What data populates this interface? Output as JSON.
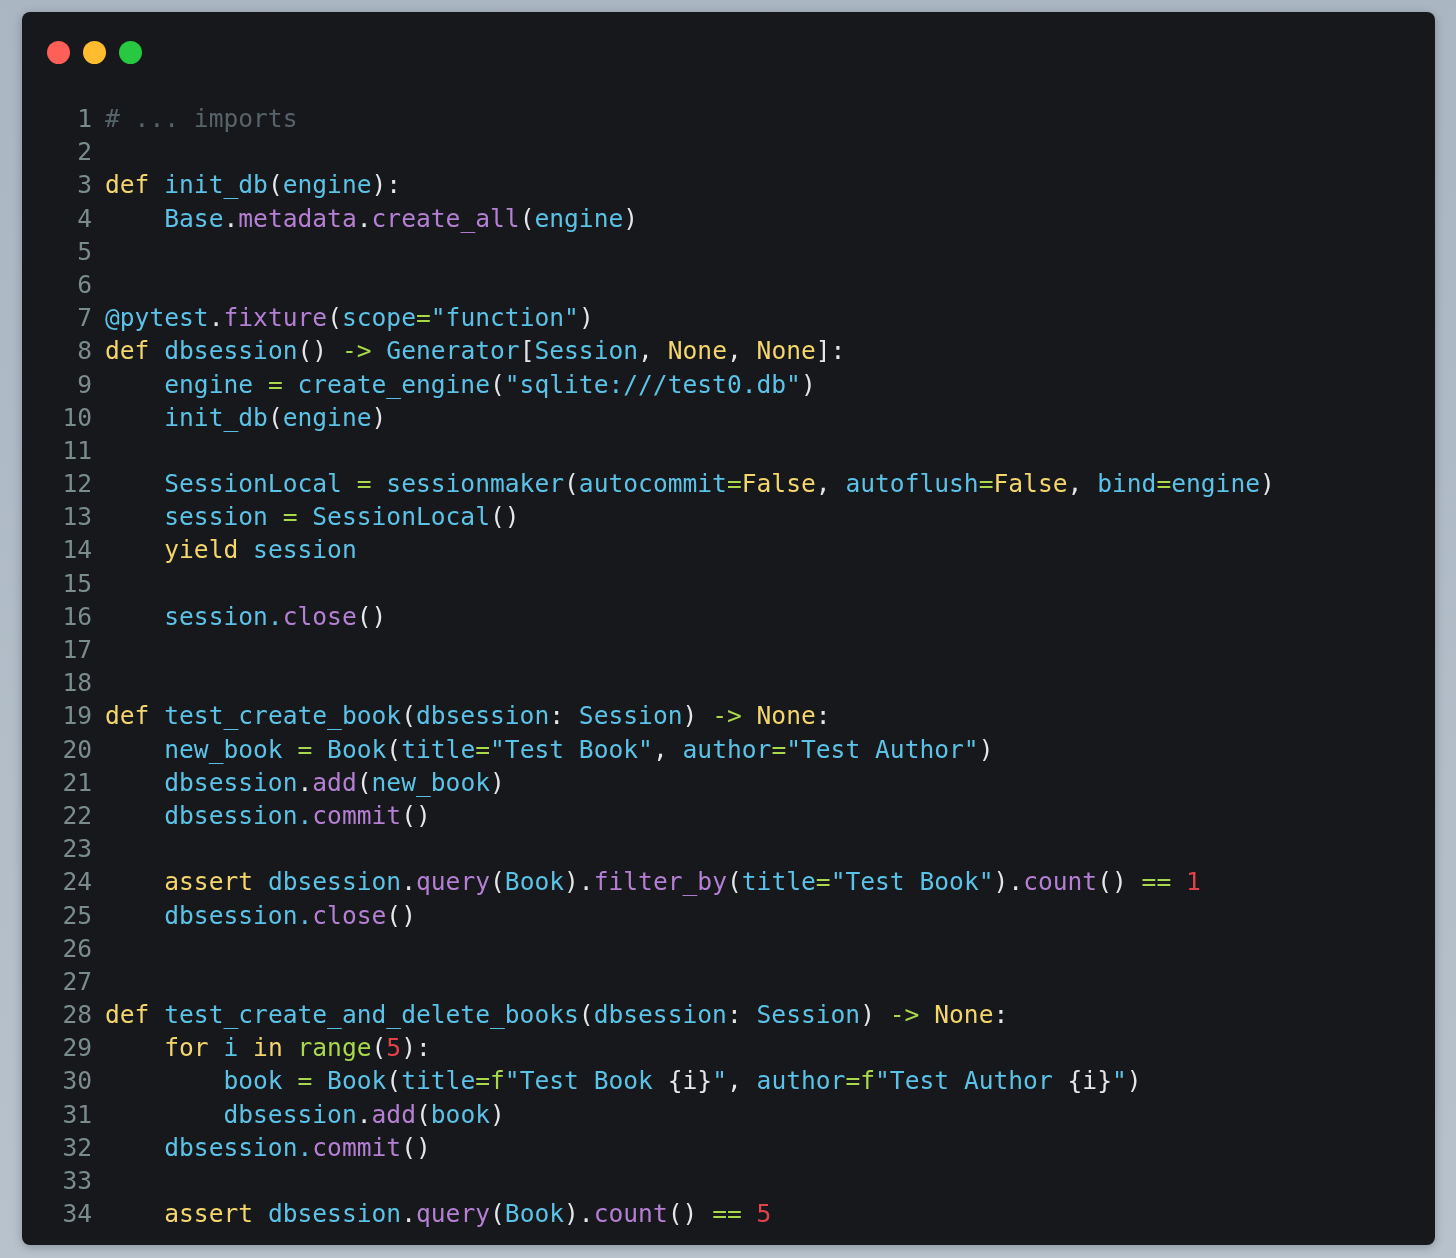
{
  "editor": {
    "lines": [
      {
        "number": "1",
        "tokens": [
          {
            "kind": "comment",
            "text": "# ... imports"
          }
        ]
      },
      {
        "number": "2"
      },
      {
        "number": "3",
        "tokens": [
          {
            "kind": "keyword",
            "text": "def"
          },
          {
            "kind": "name",
            "text": " init_db"
          },
          {
            "kind": "punct",
            "text": "("
          },
          {
            "kind": "name",
            "text": "engine"
          },
          {
            "kind": "punct",
            "text": "):"
          }
        ]
      },
      {
        "number": "4",
        "tokens": [
          {
            "kind": "name",
            "text": "    Base"
          },
          {
            "kind": "punct",
            "text": "."
          },
          {
            "kind": "method",
            "text": "metadata"
          },
          {
            "kind": "punct",
            "text": "."
          },
          {
            "kind": "method",
            "text": "create_all"
          },
          {
            "kind": "punct",
            "text": "("
          },
          {
            "kind": "name",
            "text": "engine"
          },
          {
            "kind": "punct",
            "text": ")"
          }
        ]
      },
      {
        "number": "5"
      },
      {
        "number": "6"
      },
      {
        "number": "7",
        "tokens": [
          {
            "kind": "name",
            "text": "@pytest"
          },
          {
            "kind": "punct",
            "text": "."
          },
          {
            "kind": "method",
            "text": "fixture"
          },
          {
            "kind": "punct",
            "text": "("
          },
          {
            "kind": "name",
            "text": "scope"
          },
          {
            "kind": "operator",
            "text": "="
          },
          {
            "kind": "name",
            "text": "\"function\""
          },
          {
            "kind": "punct",
            "text": ")"
          }
        ]
      },
      {
        "number": "8",
        "tokens": [
          {
            "kind": "keyword",
            "text": "def"
          },
          {
            "kind": "name",
            "text": " dbsession"
          },
          {
            "kind": "punct",
            "text": "() "
          },
          {
            "kind": "operator",
            "text": "->"
          },
          {
            "kind": "name",
            "text": " Generator"
          },
          {
            "kind": "punct",
            "text": "["
          },
          {
            "kind": "name",
            "text": "Session"
          },
          {
            "kind": "punct",
            "text": ", "
          },
          {
            "kind": "keyword",
            "text": "None"
          },
          {
            "kind": "punct",
            "text": ", "
          },
          {
            "kind": "keyword",
            "text": "None"
          },
          {
            "kind": "punct",
            "text": "]:"
          }
        ]
      },
      {
        "number": "9",
        "tokens": [
          {
            "kind": "name",
            "text": "    engine "
          },
          {
            "kind": "operator",
            "text": "="
          },
          {
            "kind": "name",
            "text": " create_engine"
          },
          {
            "kind": "punct",
            "text": "("
          },
          {
            "kind": "name",
            "text": "\"sqlite:///test0.db\""
          },
          {
            "kind": "punct",
            "text": ")"
          }
        ]
      },
      {
        "number": "10",
        "tokens": [
          {
            "kind": "name",
            "text": "    init_db"
          },
          {
            "kind": "punct",
            "text": "("
          },
          {
            "kind": "name",
            "text": "engine"
          },
          {
            "kind": "punct",
            "text": ")"
          }
        ]
      },
      {
        "number": "11"
      },
      {
        "number": "12",
        "tokens": [
          {
            "kind": "name",
            "text": "    SessionLocal "
          },
          {
            "kind": "operator",
            "text": "="
          },
          {
            "kind": "name",
            "text": " sessionmaker"
          },
          {
            "kind": "punct",
            "text": "("
          },
          {
            "kind": "name",
            "text": "autocommit"
          },
          {
            "kind": "operator",
            "text": "="
          },
          {
            "kind": "keyword",
            "text": "False"
          },
          {
            "kind": "punct",
            "text": ", "
          },
          {
            "kind": "name",
            "text": "autoflush"
          },
          {
            "kind": "operator",
            "text": "="
          },
          {
            "kind": "keyword",
            "text": "False"
          },
          {
            "kind": "punct",
            "text": ", "
          },
          {
            "kind": "name",
            "text": "bind"
          },
          {
            "kind": "operator",
            "text": "="
          },
          {
            "kind": "name",
            "text": "engine"
          },
          {
            "kind": "punct",
            "text": ")"
          }
        ]
      },
      {
        "number": "13",
        "tokens": [
          {
            "kind": "name",
            "text": "    session "
          },
          {
            "kind": "operator",
            "text": "="
          },
          {
            "kind": "name",
            "text": " SessionLocal"
          },
          {
            "kind": "punct",
            "text": "()"
          }
        ]
      },
      {
        "number": "14",
        "tokens": [
          {
            "kind": "keyword",
            "text": "    yield"
          },
          {
            "kind": "name",
            "text": " session"
          }
        ]
      },
      {
        "number": "15"
      },
      {
        "number": "16",
        "tokens": [
          {
            "kind": "name",
            "text": "    session."
          },
          {
            "kind": "method",
            "text": "close"
          },
          {
            "kind": "punct",
            "text": "()"
          }
        ]
      },
      {
        "number": "17"
      },
      {
        "number": "18"
      },
      {
        "number": "19",
        "tokens": [
          {
            "kind": "keyword",
            "text": "def"
          },
          {
            "kind": "name",
            "text": " test_create_book"
          },
          {
            "kind": "punct",
            "text": "("
          },
          {
            "kind": "name",
            "text": "dbsession"
          },
          {
            "kind": "punct",
            "text": ": "
          },
          {
            "kind": "name",
            "text": "Session"
          },
          {
            "kind": "punct",
            "text": ") "
          },
          {
            "kind": "operator",
            "text": "->"
          },
          {
            "kind": "keyword",
            "text": " None"
          },
          {
            "kind": "punct",
            "text": ":"
          }
        ]
      },
      {
        "number": "20",
        "tokens": [
          {
            "kind": "name",
            "text": "    new_book "
          },
          {
            "kind": "operator",
            "text": "="
          },
          {
            "kind": "name",
            "text": " Book"
          },
          {
            "kind": "punct",
            "text": "("
          },
          {
            "kind": "name",
            "text": "title"
          },
          {
            "kind": "operator",
            "text": "="
          },
          {
            "kind": "name",
            "text": "\"Test Book\""
          },
          {
            "kind": "punct",
            "text": ", "
          },
          {
            "kind": "name",
            "text": "author"
          },
          {
            "kind": "operator",
            "text": "="
          },
          {
            "kind": "name",
            "text": "\"Test Author\""
          },
          {
            "kind": "punct",
            "text": ")"
          }
        ]
      },
      {
        "number": "21",
        "tokens": [
          {
            "kind": "name",
            "text": "    dbsession"
          },
          {
            "kind": "punct",
            "text": "."
          },
          {
            "kind": "method",
            "text": "add"
          },
          {
            "kind": "punct",
            "text": "("
          },
          {
            "kind": "name",
            "text": "new_book"
          },
          {
            "kind": "punct",
            "text": ")"
          }
        ]
      },
      {
        "number": "22",
        "tokens": [
          {
            "kind": "name",
            "text": "    dbsession."
          },
          {
            "kind": "method",
            "text": "commit"
          },
          {
            "kind": "punct",
            "text": "()"
          }
        ]
      },
      {
        "number": "23"
      },
      {
        "number": "24",
        "tokens": [
          {
            "kind": "keyword",
            "text": "    assert"
          },
          {
            "kind": "name",
            "text": " dbsession"
          },
          {
            "kind": "punct",
            "text": "."
          },
          {
            "kind": "method",
            "text": "query"
          },
          {
            "kind": "punct",
            "text": "("
          },
          {
            "kind": "name",
            "text": "Book"
          },
          {
            "kind": "punct",
            "text": ")."
          },
          {
            "kind": "method",
            "text": "filter_by"
          },
          {
            "kind": "punct",
            "text": "("
          },
          {
            "kind": "name",
            "text": "title"
          },
          {
            "kind": "operator",
            "text": "="
          },
          {
            "kind": "name",
            "text": "\"Test Book\""
          },
          {
            "kind": "punct",
            "text": ")."
          },
          {
            "kind": "method",
            "text": "count"
          },
          {
            "kind": "punct",
            "text": "() "
          },
          {
            "kind": "operator",
            "text": "=="
          },
          {
            "kind": "number",
            "text": " 1"
          }
        ]
      },
      {
        "number": "25",
        "tokens": [
          {
            "kind": "name",
            "text": "    dbsession."
          },
          {
            "kind": "method",
            "text": "close"
          },
          {
            "kind": "punct",
            "text": "()"
          }
        ]
      },
      {
        "number": "26"
      },
      {
        "number": "27"
      },
      {
        "number": "28",
        "tokens": [
          {
            "kind": "keyword",
            "text": "def"
          },
          {
            "kind": "name",
            "text": " test_create_and_delete_books"
          },
          {
            "kind": "punct",
            "text": "("
          },
          {
            "kind": "name",
            "text": "dbsession"
          },
          {
            "kind": "punct",
            "text": ": "
          },
          {
            "kind": "name",
            "text": "Session"
          },
          {
            "kind": "punct",
            "text": ") "
          },
          {
            "kind": "operator",
            "text": "->"
          },
          {
            "kind": "keyword",
            "text": " None"
          },
          {
            "kind": "punct",
            "text": ":"
          }
        ]
      },
      {
        "number": "29",
        "tokens": [
          {
            "kind": "keyword",
            "text": "    for"
          },
          {
            "kind": "name",
            "text": " i"
          },
          {
            "kind": "keyword",
            "text": " in"
          },
          {
            "kind": "operator",
            "text": " range"
          },
          {
            "kind": "punct",
            "text": "("
          },
          {
            "kind": "number",
            "text": "5"
          },
          {
            "kind": "punct",
            "text": "):"
          }
        ]
      },
      {
        "number": "30",
        "tokens": [
          {
            "kind": "name",
            "text": "        book "
          },
          {
            "kind": "operator",
            "text": "="
          },
          {
            "kind": "name",
            "text": " Book"
          },
          {
            "kind": "punct",
            "text": "("
          },
          {
            "kind": "name",
            "text": "title"
          },
          {
            "kind": "operator",
            "text": "=f"
          },
          {
            "kind": "name",
            "text": "\"Test Book "
          },
          {
            "kind": "punct",
            "text": "{i}"
          },
          {
            "kind": "name",
            "text": "\""
          },
          {
            "kind": "punct",
            "text": ", "
          },
          {
            "kind": "name",
            "text": "author"
          },
          {
            "kind": "operator",
            "text": "=f"
          },
          {
            "kind": "name",
            "text": "\"Test Author "
          },
          {
            "kind": "punct",
            "text": "{i}"
          },
          {
            "kind": "name",
            "text": "\""
          },
          {
            "kind": "punct",
            "text": ")"
          }
        ]
      },
      {
        "number": "31",
        "tokens": [
          {
            "kind": "name",
            "text": "        dbsession"
          },
          {
            "kind": "punct",
            "text": "."
          },
          {
            "kind": "method",
            "text": "add"
          },
          {
            "kind": "punct",
            "text": "("
          },
          {
            "kind": "name",
            "text": "book"
          },
          {
            "kind": "punct",
            "text": ")"
          }
        ]
      },
      {
        "number": "32",
        "tokens": [
          {
            "kind": "name",
            "text": "    dbsession."
          },
          {
            "kind": "method",
            "text": "commit"
          },
          {
            "kind": "punct",
            "text": "()"
          }
        ]
      },
      {
        "number": "33"
      },
      {
        "number": "34",
        "tokens": [
          {
            "kind": "keyword",
            "text": "    assert"
          },
          {
            "kind": "name",
            "text": " dbsession"
          },
          {
            "kind": "punct",
            "text": "."
          },
          {
            "kind": "method",
            "text": "query"
          },
          {
            "kind": "punct",
            "text": "("
          },
          {
            "kind": "name",
            "text": "Book"
          },
          {
            "kind": "punct",
            "text": ")."
          },
          {
            "kind": "method",
            "text": "count"
          },
          {
            "kind": "punct",
            "text": "() "
          },
          {
            "kind": "operator",
            "text": "=="
          },
          {
            "kind": "number",
            "text": " 5"
          }
        ]
      }
    ]
  }
}
